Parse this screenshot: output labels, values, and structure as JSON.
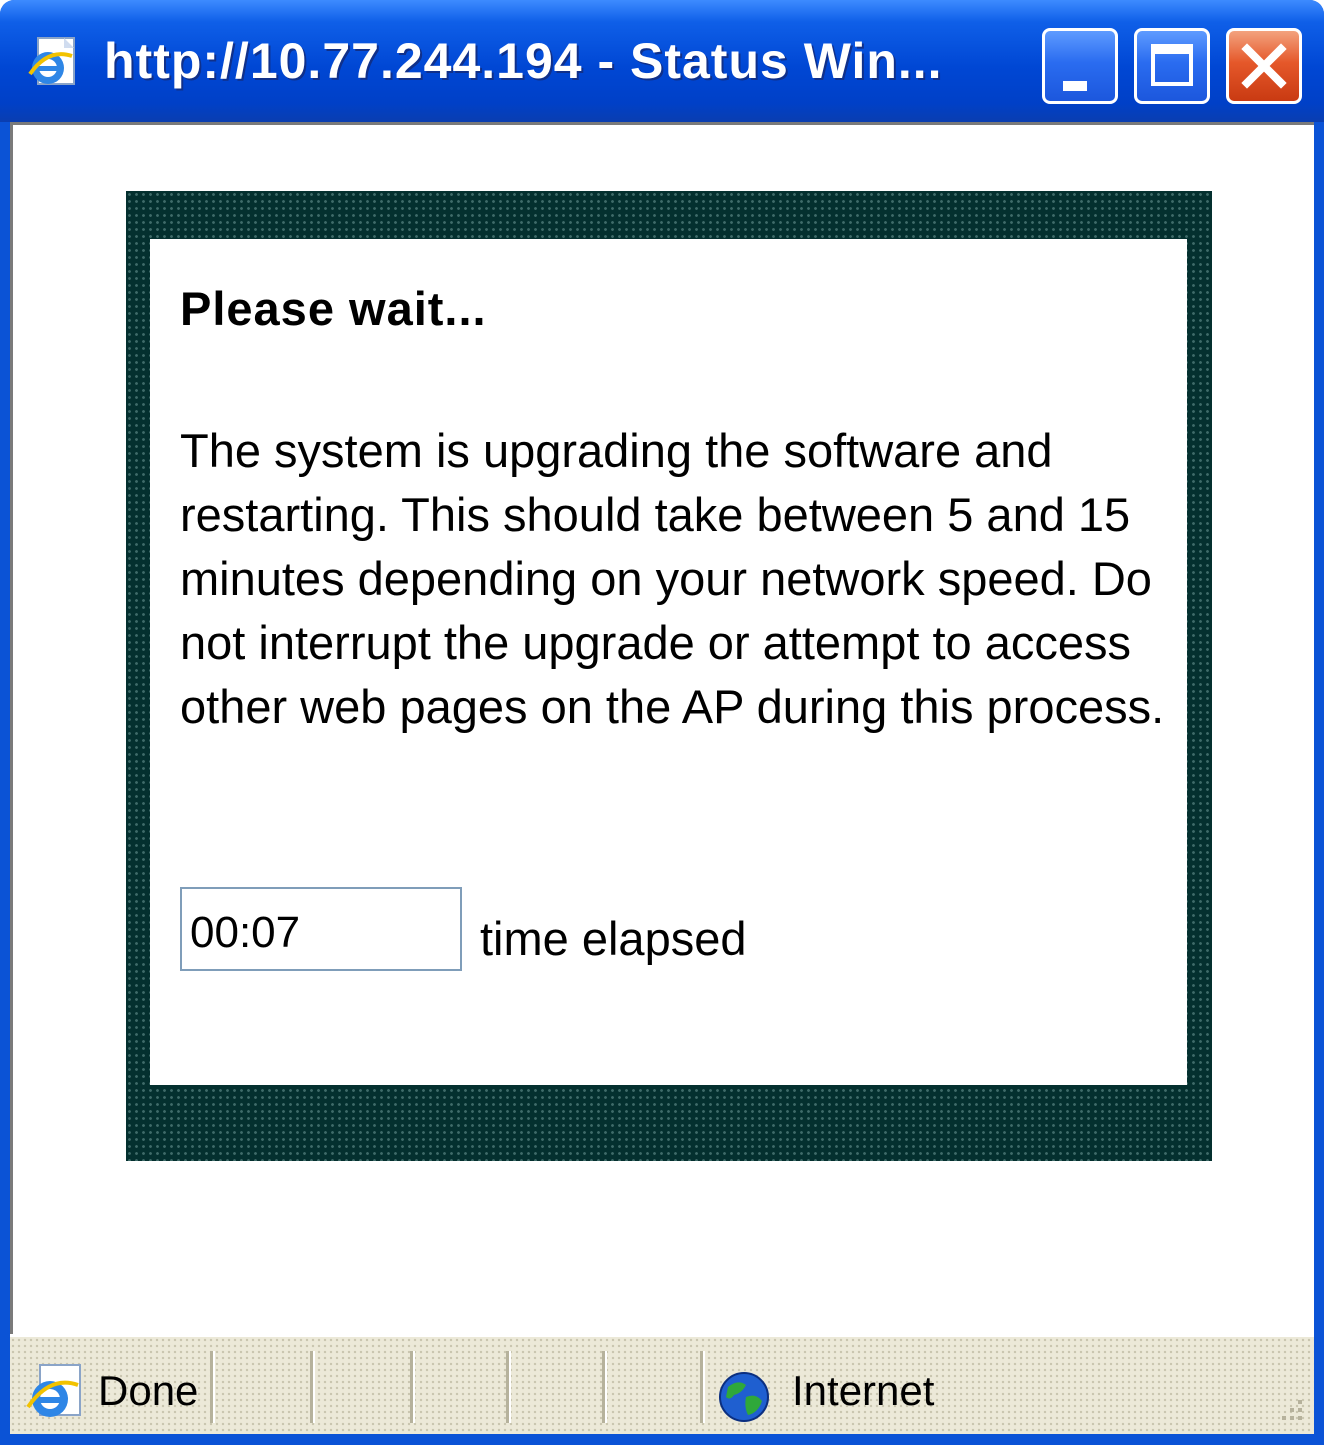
{
  "window": {
    "title": "http://10.77.244.194 - Status Win..."
  },
  "dialog": {
    "heading": "Please wait...",
    "message": "The system is upgrading the software and restarting. This should take between 5 and 15 minutes depending on your network speed. Do not interrupt the upgrade or attempt to access other web pages on the AP during this process.",
    "timer_value": "00:07",
    "timer_label": "time elapsed"
  },
  "statusbar": {
    "status": "Done",
    "zone": "Internet"
  },
  "icons": {
    "title": "ie-page-icon",
    "minimize": "minimize-icon",
    "maximize": "maximize-icon",
    "close": "close-icon",
    "status": "ie-icon",
    "zone": "globe-icon"
  },
  "colors": {
    "titlebar": "#0047d4",
    "panel": "#04302f",
    "close_button": "#e5582a",
    "statusbar": "#ece9d8"
  }
}
